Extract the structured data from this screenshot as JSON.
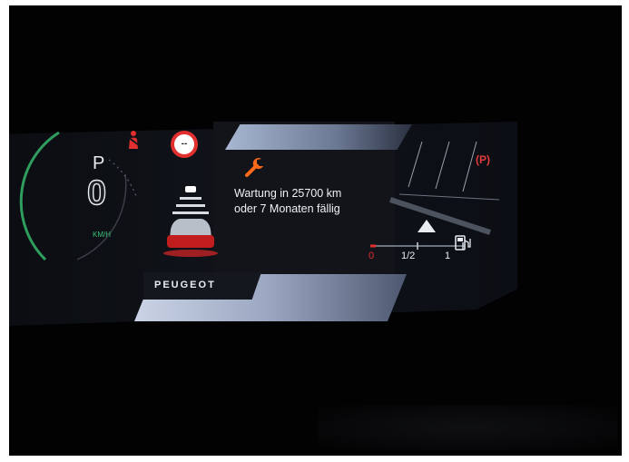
{
  "brand": "PEUGEOT",
  "gear": {
    "park": "P",
    "digit": "0"
  },
  "speed_unit": "KM/H",
  "speed_limit_value": "--",
  "service": {
    "line1": "Wartung in 25700 km",
    "line2": "oder 7 Monaten fällig",
    "icon": "wrench-icon"
  },
  "parking_brake": "(P)",
  "fuel": {
    "empty_label": "0",
    "half_label": "1/2",
    "full_label": "1",
    "icon": "fuel-pump-icon",
    "level": 0.05
  },
  "colors": {
    "warning_red": "#e23030",
    "accent_orange": "#ff6a1a",
    "gauge_green": "#39c07a"
  }
}
